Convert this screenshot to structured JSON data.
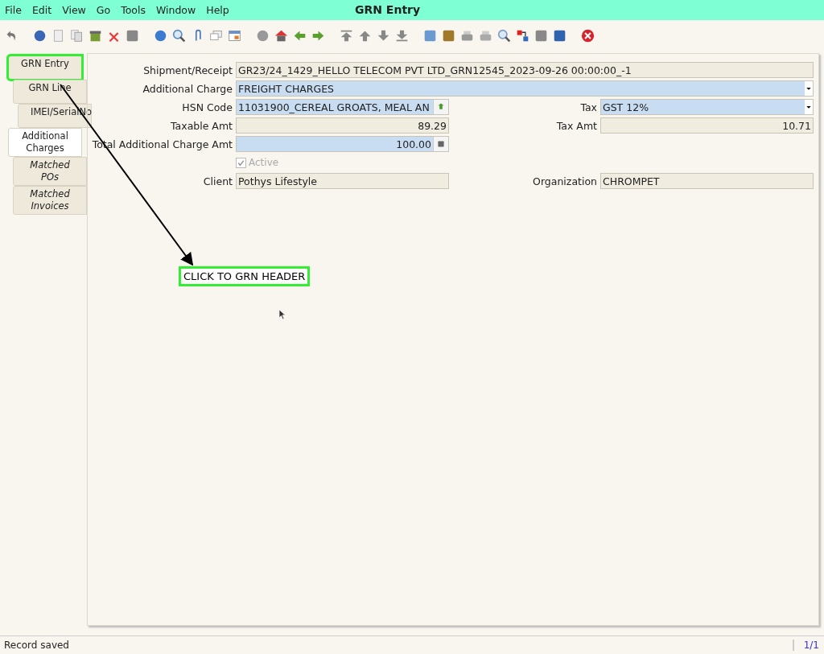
{
  "menu": [
    "File",
    "Edit",
    "View",
    "Go",
    "Tools",
    "Window",
    "Help"
  ],
  "window": {
    "title": "GRN Entry"
  },
  "tabs": [
    {
      "label": "GRN Entry",
      "selected": false,
      "italic": false,
      "highlighted": true,
      "children": [
        {
          "label": "GRN Line",
          "selected": false,
          "italic": false,
          "highlighted": false,
          "children": [
            {
              "label": "IMEI/SerialNo",
              "selected": false,
              "italic": false,
              "highlighted": false
            }
          ]
        }
      ]
    },
    {
      "label": "Additional Charges",
      "selected": true,
      "italic": false,
      "highlighted": false,
      "children": [
        {
          "label": "Matched POs",
          "selected": false,
          "italic": true,
          "highlighted": false
        },
        {
          "label": "Matched Invoices",
          "selected": false,
          "italic": true,
          "highlighted": false
        }
      ]
    }
  ],
  "form": {
    "rows": [
      {
        "fields": [
          {
            "kind": "text",
            "label": "Shipment/Receipt",
            "value": "GR23/24_1429_HELLO TELECOM PVT LTD_GRN12545_2023-09-26 00:00:00_-1",
            "mandatory": false
          }
        ]
      },
      {
        "fields": [
          {
            "kind": "combo",
            "label": "Additional Charge",
            "value": "FREIGHT CHARGES",
            "mandatory": true
          }
        ]
      },
      {
        "fields": [
          {
            "kind": "search",
            "label": "HSN Code",
            "value": "11031900_CEREAL GROATS, MEAL AN",
            "mandatory": true
          },
          {
            "kind": "combo",
            "label": "Tax",
            "value": "GST 12%",
            "mandatory": true
          }
        ]
      },
      {
        "fields": [
          {
            "kind": "number",
            "label": "Taxable Amt",
            "value": "89.29",
            "mandatory": false
          },
          {
            "kind": "number",
            "label": "Tax Amt",
            "value": "10.71",
            "mandatory": false
          }
        ]
      },
      {
        "fields": [
          {
            "kind": "amount",
            "label": "Total Additional Charge Amt",
            "value": "100.00",
            "mandatory": true
          }
        ]
      },
      {
        "fields": [
          {
            "kind": "checkbox",
            "label": "Active",
            "checked": true,
            "disabled": true
          }
        ]
      },
      {
        "fields": [
          {
            "kind": "text",
            "label": "Client",
            "value": "Pothys Lifestyle",
            "mandatory": false
          },
          {
            "kind": "text",
            "label": "Organization",
            "value": "CHROMPET",
            "mandatory": false
          }
        ]
      }
    ]
  },
  "annotation": {
    "text": "CLICK TO GRN HEADER"
  },
  "status_bar": {
    "message": "Record saved",
    "record": "1/1"
  }
}
